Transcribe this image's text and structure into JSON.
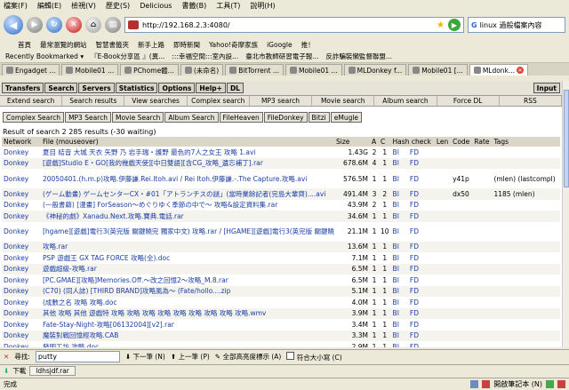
{
  "menubar": [
    "檔案(F)",
    "編輯(E)",
    "檢視(V)",
    "歷史(S)",
    "Delicious",
    "書籤(B)",
    "工具(T)",
    "說明(H)"
  ],
  "nav": {
    "url": "http://192.168.2.3:4080/",
    "search": "linux 過般檔案內容"
  },
  "bookmarks": [
    "首頁",
    "最常瀏覽的網站",
    "智慧書籤夾",
    "新手上路",
    "即時新聞",
    "Yahoo!奇摩家族",
    "iGoogle",
    "推！"
  ],
  "bookmarks2": [
    "Recently Bookmarked ▾",
    "『E-Book分享區 』(異...",
    ":::幸福空間:::室內設...",
    "臺北市教師研習電子報...",
    "反詐騙裝懶監督聯盟..."
  ],
  "tabs": [
    "Engadget ...",
    "Mobile01 ...",
    "PChome體...",
    "(未命名)",
    "BitTorrent ...",
    "Mobile01 ...",
    "MLDonkey f...",
    "Mobile01 [...",
    "MLdonk..."
  ],
  "ml": {
    "topbar": [
      "Transfers",
      "Search",
      "Servers",
      "Statistics",
      "Options",
      "Help+",
      "DL"
    ],
    "input_btn": "Input",
    "sub": [
      "Extend search",
      "Search results",
      "View searches",
      "Complex search",
      "MP3 search",
      "Movie search",
      "Album search",
      "Force DL",
      "RSS"
    ],
    "search_types": [
      "Complex Search",
      "MP3 Search",
      "Movie Search",
      "Album Search",
      "FileHeaven",
      "FileDonkey",
      "Bitzi",
      "eMugle"
    ],
    "result_text": "Result of search 2 285 results (-30 waiting)",
    "headers": [
      "Network",
      "File (mouseover)",
      "Size",
      "A",
      "C",
      "Hash check",
      "Len",
      "Code",
      "Rate",
      "Tags"
    ],
    "rows": [
      {
        "net": "Donkey",
        "file": "夏目 結音 大城 天衣 矢野 乃 岩手瑞・護野 最色的7人之女王 攻略 1.avi",
        "size": "1.43G",
        "a": "2",
        "c": "1",
        "b": "BI",
        "f": "FD",
        "code": "",
        "tags": ""
      },
      {
        "net": "Donkey",
        "file": "[遊戲]Studio E・GO[我的幾戲天使][中日雙語][含CG_攻略_遺忘補丁].rar",
        "size": "678.6M",
        "a": "4",
        "c": "1",
        "b": "BI",
        "f": "FD",
        "code": "",
        "tags": ""
      },
      {
        "net": "Donkey",
        "file": "20050401.(h.m.p)攻略.伊藤謙.Rei.Itoh.avi / Rei Itoh.伊藤謙.-.The Capture.攻略.avi",
        "size": "576.5M",
        "a": "1",
        "c": "1",
        "b": "BI",
        "f": "FD",
        "code": "y41p",
        "tags": "(mlen) (lastcompl)",
        "two": true
      },
      {
        "net": "Donkey",
        "file": "(ゲーム動畫) ゲームセンターCX・#01「アトランチスの謎」(當時業餘記者(完島大輩齊)....avi",
        "size": "491.4M",
        "a": "3",
        "c": "2",
        "b": "BI",
        "f": "FD",
        "code": "dx50",
        "tags": "1185 (mlen)"
      },
      {
        "net": "Donkey",
        "file": "(一般書籍) [漫畫] ForSeason～めぐりゆく季節の中で～ 攻略&設定資料集.rar",
        "size": "43.9M",
        "a": "2",
        "c": "1",
        "b": "BI",
        "f": "FD",
        "code": "",
        "tags": ""
      },
      {
        "net": "Donkey",
        "file": "《神秘的劇》Xanadu.Next.攻略.寶典.電話.rar",
        "size": "34.6M",
        "a": "1",
        "c": "1",
        "b": "BI",
        "f": "FD",
        "code": "",
        "tags": ""
      },
      {
        "net": "Donkey",
        "file": "[hgame][遊戲]電行3(英完版 關鍵曉完 獨家中文) 攻略.rar / [HGAME][遊戲]電行3(英完版 關鍵曉完 獨家中文) 攻略.rar",
        "size": "21.1M",
        "a": "1",
        "c": "10",
        "b": "BI",
        "f": "FD",
        "code": "",
        "tags": "",
        "two": true
      },
      {
        "net": "Donkey",
        "file": "攻略.rar",
        "size": "13.6M",
        "a": "1",
        "c": "1",
        "b": "BI",
        "f": "FD",
        "code": "",
        "tags": ""
      },
      {
        "net": "Donkey",
        "file": "PSP 遊戲王 GX TAG FORCE 攻略(全).doc",
        "size": "7.1M",
        "a": "1",
        "c": "1",
        "b": "BI",
        "f": "FD",
        "code": "",
        "tags": ""
      },
      {
        "net": "Donkey",
        "file": "遊戲超級-攻略.rar",
        "size": "6.5M",
        "a": "1",
        "c": "1",
        "b": "BI",
        "f": "FD",
        "code": "",
        "tags": ""
      },
      {
        "net": "Donkey",
        "file": "[PC.GMAE][攻略]Memories.Off.～改之回憶2～攻略_M.8.rar",
        "size": "6.5M",
        "a": "1",
        "c": "1",
        "b": "BI",
        "f": "FD",
        "code": "",
        "tags": ""
      },
      {
        "net": "Donkey",
        "file": "(C70) (同人誌) [THIRD BRAND]攻略風為～ (Fate/hollo....zip",
        "size": "5.1M",
        "a": "1",
        "c": "1",
        "b": "BI",
        "f": "FD",
        "code": "",
        "tags": ""
      },
      {
        "net": "Donkey",
        "file": "(成數之名 攻略 攻略.doc",
        "size": "4.0M",
        "a": "1",
        "c": "1",
        "b": "BI",
        "f": "FD",
        "code": "",
        "tags": ""
      },
      {
        "net": "Donkey",
        "file": "其他 攻略 其他 遊戲特 攻略 攻略 攻略 攻略 攻略 攻略 攻略 攻略 攻略.wmv",
        "size": "3.9M",
        "a": "1",
        "c": "1",
        "b": "BI",
        "f": "FD",
        "code": "",
        "tags": ""
      },
      {
        "net": "Donkey",
        "file": "Fate-Stay-Night-攻略[06132004][v2].rar",
        "size": "3.4M",
        "a": "1",
        "c": "1",
        "b": "BI",
        "f": "FD",
        "code": "",
        "tags": ""
      },
      {
        "net": "Donkey",
        "file": "魔裝對戰回憶經攻略.CAB",
        "size": "3.3M",
        "a": "1",
        "c": "1",
        "b": "BI",
        "f": "FD",
        "code": "",
        "tags": ""
      },
      {
        "net": "Donkey",
        "file": "發明工坊 攻略.doc",
        "size": "2.9M",
        "a": "1",
        "c": "1",
        "b": "BI",
        "f": "FD",
        "code": "",
        "tags": ""
      },
      {
        "net": "Donkey",
        "file": "發明工坊 攻略.doc",
        "size": "2.9M",
        "a": "1",
        "c": "1",
        "b": "BI",
        "f": "FD",
        "code": "",
        "tags": ""
      },
      {
        "net": "Donkey",
        "file": "發明工坊 攻略.doc",
        "size": "2.8M",
        "a": "1",
        "c": "1",
        "b": "BI",
        "f": "FD",
        "code": "",
        "tags": ""
      }
    ]
  },
  "findbar": {
    "label": "尋找:",
    "value": "putty",
    "next": "下一筆 (N)",
    "prev": "上一筆 (P)",
    "highlight": "全部高亮度標示 (A)",
    "matchcase": "符合大小寫 (C)"
  },
  "dlbar": {
    "label": "下載",
    "item": "ldhsjdf.rar"
  },
  "statusbar": {
    "text": "完成",
    "right": "開啟筆記本 (N)"
  }
}
